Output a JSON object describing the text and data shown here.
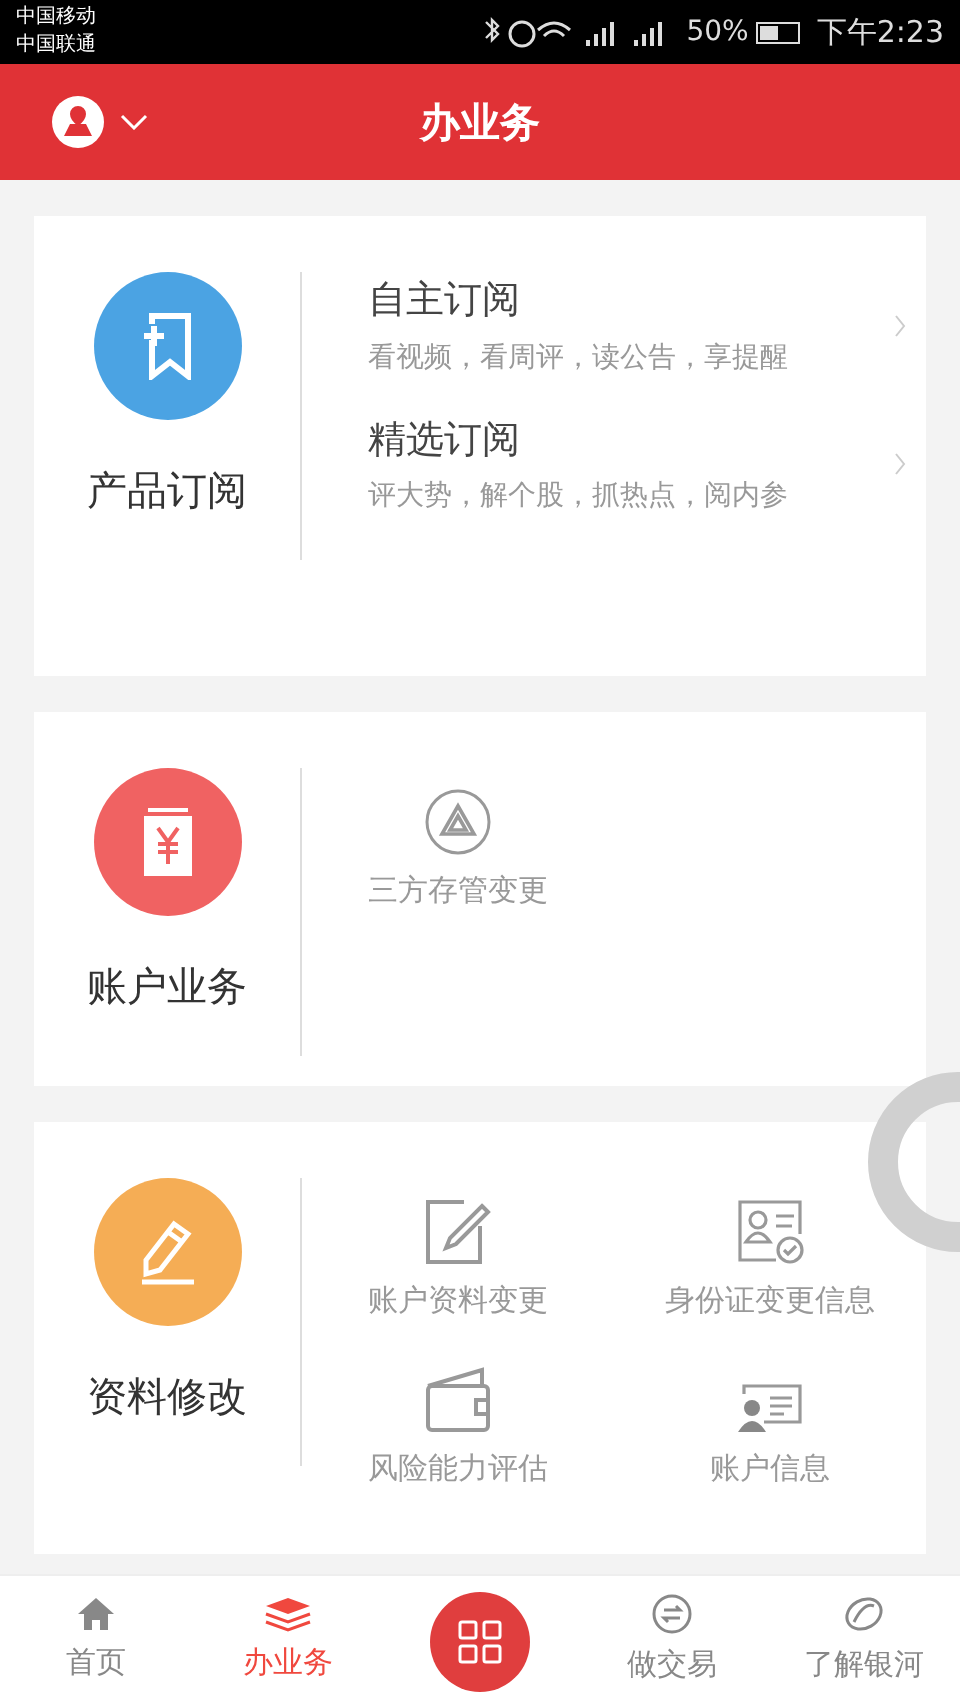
{
  "status_bar": {
    "carriers": [
      "中国移动",
      "中国联通"
    ],
    "battery": "50%",
    "time": "下午2:23"
  },
  "header": {
    "title": "办业务"
  },
  "sections": [
    {
      "kind": "subscribe",
      "title": "产品订阅",
      "color": "#4ba3e3",
      "items": [
        {
          "title": "自主订阅",
          "desc": "看视频，看周评，读公告，享提醒"
        },
        {
          "title": "精选订阅",
          "desc": "评大势，解个股，抓热点，阅内参"
        }
      ]
    },
    {
      "kind": "grid",
      "title": "账户业务",
      "color": "#f06262",
      "items": [
        {
          "label": "三方存管变更"
        }
      ]
    },
    {
      "kind": "grid",
      "title": "资料修改",
      "color": "#f5ad55",
      "items": [
        {
          "label": "账户资料变更"
        },
        {
          "label": "身份证变更信息"
        },
        {
          "label": "风险能力评估"
        },
        {
          "label": "账户信息"
        }
      ]
    }
  ],
  "tabs": [
    {
      "kind": "home",
      "label": "首页",
      "selected": false
    },
    {
      "kind": "layers",
      "label": "办业务",
      "selected": true
    },
    {
      "kind": "center",
      "selected": false
    },
    {
      "kind": "exchange",
      "label": "做交易",
      "selected": false
    },
    {
      "kind": "ring",
      "label": "了解银河",
      "selected": false
    }
  ]
}
